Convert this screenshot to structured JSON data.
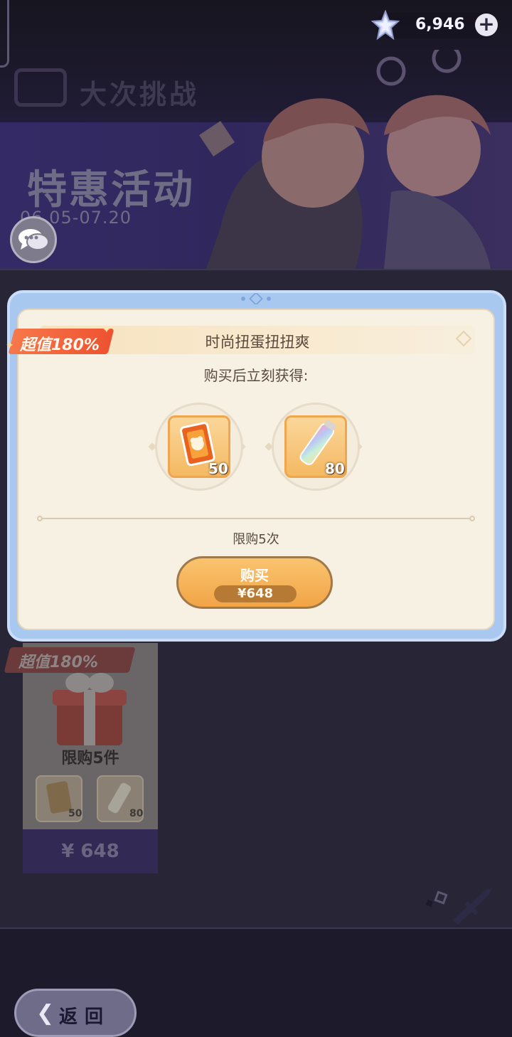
{
  "currency": {
    "icon": "star-crystal-icon",
    "value": "6,946",
    "add_label": "+"
  },
  "event_banner": {
    "label": "大次挑战",
    "title": "特惠活动",
    "dates": "06.05-07.20"
  },
  "shop_card": {
    "badge": "超值180%",
    "limit": "限购5件",
    "items": [
      {
        "icon": "card-pack-icon",
        "count": "50"
      },
      {
        "icon": "paint-tube-icon",
        "count": "80"
      }
    ],
    "price": "¥ 648"
  },
  "modal": {
    "badge": "超值180%",
    "title": "时尚扭蛋扭扭爽",
    "subtitle": "购买后立刻获得:",
    "items": [
      {
        "icon": "card-pack-icon",
        "count": "50"
      },
      {
        "icon": "paint-tube-icon",
        "count": "80"
      }
    ],
    "limit_text": "限购5次",
    "buy_label": "购买",
    "price": "¥648"
  },
  "back_button": {
    "label": "返回",
    "icon": "back-arrow-icon"
  },
  "colors": {
    "accent_orange": "#f2a447",
    "badge_red": "#ee5230",
    "modal_frame": "#a9c8f0",
    "modal_bg": "#f7f1e4"
  }
}
